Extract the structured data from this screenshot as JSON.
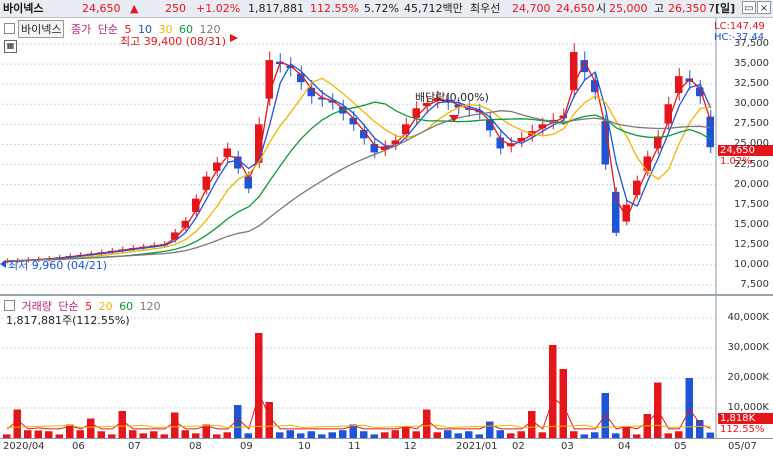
{
  "header": {
    "name": "바이넥스",
    "price": "24,650",
    "arrow": "▲",
    "change": "250",
    "change_pct": "+1.02%",
    "volume": "1,817,881",
    "volume_ratio": "112.55%",
    "turnover": "5.72%",
    "amount": "45,712백만",
    "ask_label": "최우선",
    "ask": "24,700",
    "bid": "24,650",
    "open_label": "시",
    "open": "25,000",
    "high_label": "고",
    "high": "26,350",
    "period_btn": "[일]",
    "open_bracket": "7"
  },
  "price_panel": {
    "stock_box": "바이넥스",
    "legend": [
      "종가",
      "단순",
      "5",
      "10",
      "30",
      "60",
      "120"
    ],
    "max_label": "최고 39,400 (08/31)",
    "min_label": "최저 9,960 (04/21)",
    "dividend_label": "배당락(0.00%)",
    "lc": "LC:147.49",
    "hc": "HC:-37.44",
    "price_tag": "24,650",
    "pct_tag": "1.02%",
    "y_ticks": [
      "37,500",
      "35,000",
      "32,500",
      "30,000",
      "27,500",
      "25,000",
      "22,500",
      "20,000",
      "17,500",
      "15,000",
      "12,500",
      "10,000",
      "7,500"
    ]
  },
  "volume_panel": {
    "legend": [
      "거래량",
      "단순",
      "5",
      "20",
      "60",
      "120"
    ],
    "vol_info": "1,817,881주(112.55%)",
    "vol_tag": "1,818K",
    "vol_pct": "112.55%",
    "y_ticks": [
      "40,000K",
      "30,000K",
      "20,000K",
      "10,000K"
    ]
  },
  "x_axis": [
    "2020/04",
    "06",
    "07",
    "08",
    "09",
    "10",
    "11",
    "12",
    "2021/01",
    "02",
    "03",
    "04",
    "05",
    "05/07"
  ],
  "colors": {
    "up": "#e4161b",
    "down": "#1d55d6",
    "ma5": "#e4161b",
    "ma10": "#1d55d6",
    "ma30": "#f0b400",
    "ma60": "#0a9b34",
    "ma120": "#7a7a7a"
  },
  "chart_data": {
    "type": "candlestick",
    "price_ylim": [
      7500,
      37500
    ],
    "volume_ylim_k": [
      0,
      40000
    ],
    "price_path": [
      [
        0,
        10500
      ],
      [
        4,
        10800
      ],
      [
        8,
        11400
      ],
      [
        12,
        12100
      ],
      [
        15,
        12600
      ],
      [
        17,
        15500
      ],
      [
        19,
        21000
      ],
      [
        21,
        24500
      ],
      [
        23,
        19500
      ],
      [
        25,
        35500
      ],
      [
        27,
        34500
      ],
      [
        29,
        31000
      ],
      [
        31,
        30200
      ],
      [
        33,
        27500
      ],
      [
        35,
        24000
      ],
      [
        37,
        25500
      ],
      [
        39,
        29500
      ],
      [
        41,
        30800
      ],
      [
        43,
        29600
      ],
      [
        45,
        29000
      ],
      [
        47,
        24500
      ],
      [
        49,
        25800
      ],
      [
        51,
        27500
      ],
      [
        53,
        28600
      ],
      [
        54,
        36500
      ],
      [
        55,
        34000
      ],
      [
        56,
        31500
      ],
      [
        57,
        22500
      ],
      [
        58,
        14000
      ],
      [
        59,
        17500
      ],
      [
        60,
        20500
      ],
      [
        61,
        23500
      ],
      [
        62,
        26000
      ],
      [
        63,
        30000
      ],
      [
        64,
        33500
      ],
      [
        65,
        32800
      ],
      [
        66,
        31000
      ],
      [
        67,
        24650
      ]
    ],
    "volume_spikes_k": [
      [
        1,
        9500
      ],
      [
        3,
        2500
      ],
      [
        6,
        4500
      ],
      [
        8,
        6500
      ],
      [
        11,
        9000
      ],
      [
        16,
        8500
      ],
      [
        19,
        4500
      ],
      [
        22,
        11000
      ],
      [
        24,
        35000
      ],
      [
        25,
        12000
      ],
      [
        33,
        4500
      ],
      [
        38,
        3500
      ],
      [
        40,
        9500
      ],
      [
        46,
        5500
      ],
      [
        50,
        9000
      ],
      [
        52,
        31000
      ],
      [
        53,
        23000
      ],
      [
        57,
        15000
      ],
      [
        59,
        3500
      ],
      [
        61,
        8000
      ],
      [
        62,
        18500
      ],
      [
        65,
        20000
      ],
      [
        66,
        6000
      ],
      [
        67,
        1818
      ]
    ]
  }
}
